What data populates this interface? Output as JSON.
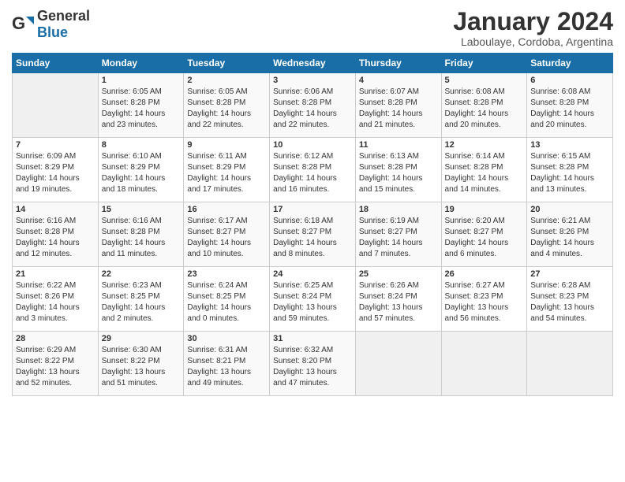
{
  "logo": {
    "general": "General",
    "blue": "Blue"
  },
  "header": {
    "month": "January 2024",
    "location": "Laboulaye, Cordoba, Argentina"
  },
  "weekdays": [
    "Sunday",
    "Monday",
    "Tuesday",
    "Wednesday",
    "Thursday",
    "Friday",
    "Saturday"
  ],
  "weeks": [
    [
      {
        "day": "",
        "empty": true
      },
      {
        "day": "1",
        "sunrise": "Sunrise: 6:05 AM",
        "sunset": "Sunset: 8:28 PM",
        "daylight": "Daylight: 14 hours and 23 minutes."
      },
      {
        "day": "2",
        "sunrise": "Sunrise: 6:05 AM",
        "sunset": "Sunset: 8:28 PM",
        "daylight": "Daylight: 14 hours and 22 minutes."
      },
      {
        "day": "3",
        "sunrise": "Sunrise: 6:06 AM",
        "sunset": "Sunset: 8:28 PM",
        "daylight": "Daylight: 14 hours and 22 minutes."
      },
      {
        "day": "4",
        "sunrise": "Sunrise: 6:07 AM",
        "sunset": "Sunset: 8:28 PM",
        "daylight": "Daylight: 14 hours and 21 minutes."
      },
      {
        "day": "5",
        "sunrise": "Sunrise: 6:08 AM",
        "sunset": "Sunset: 8:28 PM",
        "daylight": "Daylight: 14 hours and 20 minutes."
      },
      {
        "day": "6",
        "sunrise": "Sunrise: 6:08 AM",
        "sunset": "Sunset: 8:28 PM",
        "daylight": "Daylight: 14 hours and 20 minutes."
      }
    ],
    [
      {
        "day": "7",
        "sunrise": "Sunrise: 6:09 AM",
        "sunset": "Sunset: 8:29 PM",
        "daylight": "Daylight: 14 hours and 19 minutes."
      },
      {
        "day": "8",
        "sunrise": "Sunrise: 6:10 AM",
        "sunset": "Sunset: 8:29 PM",
        "daylight": "Daylight: 14 hours and 18 minutes."
      },
      {
        "day": "9",
        "sunrise": "Sunrise: 6:11 AM",
        "sunset": "Sunset: 8:29 PM",
        "daylight": "Daylight: 14 hours and 17 minutes."
      },
      {
        "day": "10",
        "sunrise": "Sunrise: 6:12 AM",
        "sunset": "Sunset: 8:28 PM",
        "daylight": "Daylight: 14 hours and 16 minutes."
      },
      {
        "day": "11",
        "sunrise": "Sunrise: 6:13 AM",
        "sunset": "Sunset: 8:28 PM",
        "daylight": "Daylight: 14 hours and 15 minutes."
      },
      {
        "day": "12",
        "sunrise": "Sunrise: 6:14 AM",
        "sunset": "Sunset: 8:28 PM",
        "daylight": "Daylight: 14 hours and 14 minutes."
      },
      {
        "day": "13",
        "sunrise": "Sunrise: 6:15 AM",
        "sunset": "Sunset: 8:28 PM",
        "daylight": "Daylight: 14 hours and 13 minutes."
      }
    ],
    [
      {
        "day": "14",
        "sunrise": "Sunrise: 6:16 AM",
        "sunset": "Sunset: 8:28 PM",
        "daylight": "Daylight: 14 hours and 12 minutes."
      },
      {
        "day": "15",
        "sunrise": "Sunrise: 6:16 AM",
        "sunset": "Sunset: 8:28 PM",
        "daylight": "Daylight: 14 hours and 11 minutes."
      },
      {
        "day": "16",
        "sunrise": "Sunrise: 6:17 AM",
        "sunset": "Sunset: 8:27 PM",
        "daylight": "Daylight: 14 hours and 10 minutes."
      },
      {
        "day": "17",
        "sunrise": "Sunrise: 6:18 AM",
        "sunset": "Sunset: 8:27 PM",
        "daylight": "Daylight: 14 hours and 8 minutes."
      },
      {
        "day": "18",
        "sunrise": "Sunrise: 6:19 AM",
        "sunset": "Sunset: 8:27 PM",
        "daylight": "Daylight: 14 hours and 7 minutes."
      },
      {
        "day": "19",
        "sunrise": "Sunrise: 6:20 AM",
        "sunset": "Sunset: 8:27 PM",
        "daylight": "Daylight: 14 hours and 6 minutes."
      },
      {
        "day": "20",
        "sunrise": "Sunrise: 6:21 AM",
        "sunset": "Sunset: 8:26 PM",
        "daylight": "Daylight: 14 hours and 4 minutes."
      }
    ],
    [
      {
        "day": "21",
        "sunrise": "Sunrise: 6:22 AM",
        "sunset": "Sunset: 8:26 PM",
        "daylight": "Daylight: 14 hours and 3 minutes."
      },
      {
        "day": "22",
        "sunrise": "Sunrise: 6:23 AM",
        "sunset": "Sunset: 8:25 PM",
        "daylight": "Daylight: 14 hours and 2 minutes."
      },
      {
        "day": "23",
        "sunrise": "Sunrise: 6:24 AM",
        "sunset": "Sunset: 8:25 PM",
        "daylight": "Daylight: 14 hours and 0 minutes."
      },
      {
        "day": "24",
        "sunrise": "Sunrise: 6:25 AM",
        "sunset": "Sunset: 8:24 PM",
        "daylight": "Daylight: 13 hours and 59 minutes."
      },
      {
        "day": "25",
        "sunrise": "Sunrise: 6:26 AM",
        "sunset": "Sunset: 8:24 PM",
        "daylight": "Daylight: 13 hours and 57 minutes."
      },
      {
        "day": "26",
        "sunrise": "Sunrise: 6:27 AM",
        "sunset": "Sunset: 8:23 PM",
        "daylight": "Daylight: 13 hours and 56 minutes."
      },
      {
        "day": "27",
        "sunrise": "Sunrise: 6:28 AM",
        "sunset": "Sunset: 8:23 PM",
        "daylight": "Daylight: 13 hours and 54 minutes."
      }
    ],
    [
      {
        "day": "28",
        "sunrise": "Sunrise: 6:29 AM",
        "sunset": "Sunset: 8:22 PM",
        "daylight": "Daylight: 13 hours and 52 minutes."
      },
      {
        "day": "29",
        "sunrise": "Sunrise: 6:30 AM",
        "sunset": "Sunset: 8:22 PM",
        "daylight": "Daylight: 13 hours and 51 minutes."
      },
      {
        "day": "30",
        "sunrise": "Sunrise: 6:31 AM",
        "sunset": "Sunset: 8:21 PM",
        "daylight": "Daylight: 13 hours and 49 minutes."
      },
      {
        "day": "31",
        "sunrise": "Sunrise: 6:32 AM",
        "sunset": "Sunset: 8:20 PM",
        "daylight": "Daylight: 13 hours and 47 minutes."
      },
      {
        "day": "",
        "empty": true
      },
      {
        "day": "",
        "empty": true
      },
      {
        "day": "",
        "empty": true
      }
    ]
  ]
}
